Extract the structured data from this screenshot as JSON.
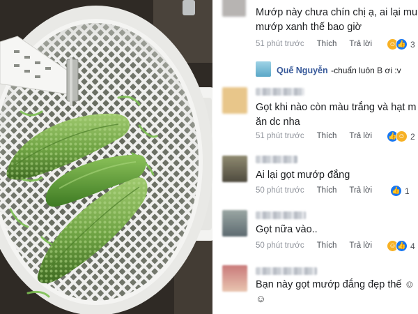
{
  "comments": [
    {
      "text_lines": [
        "Mướp này chưa chín chị ạ, ai lại mu",
        "mướp xanh thế bao giờ"
      ],
      "time": "51 phút trước",
      "like": "Thích",
      "reply": "Trả lời",
      "reaction_count": "3",
      "reactions": [
        "haha",
        "like"
      ]
    },
    {
      "reply_author": "Quế Nguyễn",
      "reply_text": "-chuẩn luôn B ơi :v"
    },
    {
      "text_lines": [
        "Gọt khi nào còn màu trắng và hạt m",
        "ăn dc nha"
      ],
      "time": "51 phút trước",
      "like": "Thích",
      "reply": "Trả lời",
      "reaction_count": "2",
      "reactions": [
        "like",
        "haha"
      ]
    },
    {
      "text_lines": [
        "Ai lại gọt mướp đắng"
      ],
      "time": "50 phút trước",
      "like": "Thích",
      "reply": "Trả lời",
      "reaction_count": "1",
      "reactions": [
        "like"
      ]
    },
    {
      "text_lines": [
        "Gọt nữa vào.."
      ],
      "time": "50 phút trước",
      "like": "Thích",
      "reply": "Trả lời",
      "reaction_count": "4",
      "reactions": [
        "haha",
        "like"
      ]
    },
    {
      "text_lines": [
        "Bạn này gọt mướp đắng đẹp thế ☺",
        "☺"
      ],
      "time": "",
      "like": "",
      "reply": "",
      "reaction_count": "",
      "reactions": []
    }
  ],
  "colors": {
    "like": "#1877f2",
    "haha": "#f7b125",
    "author": "#365899",
    "meta": "#90949c"
  },
  "icons": {
    "like": "thumbs-up-icon",
    "haha": "laughing-emoji-icon"
  }
}
